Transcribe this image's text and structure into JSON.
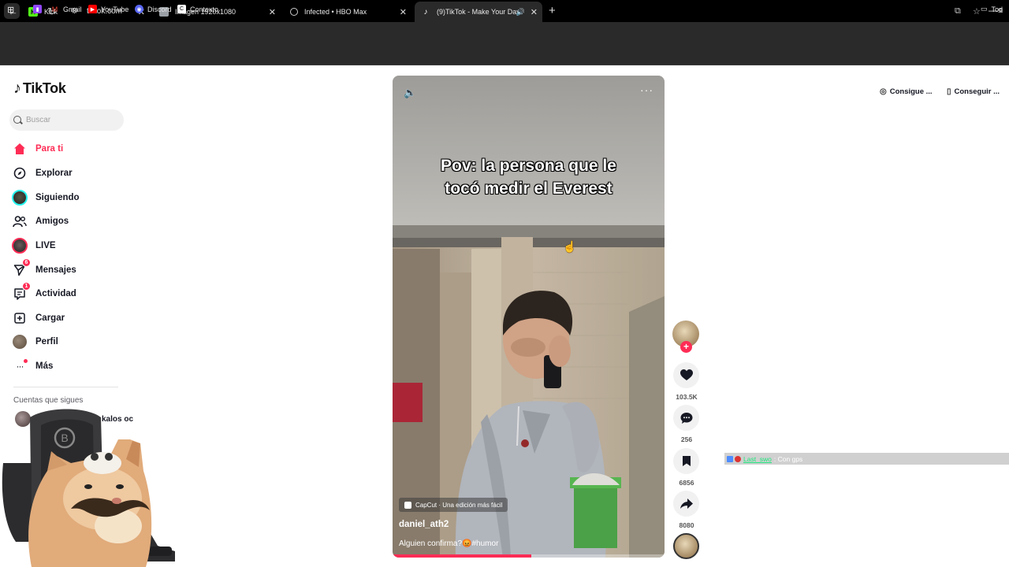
{
  "browser": {
    "tabs": [
      {
        "title": "Kick",
        "icon": "kick-icon",
        "color": "#53fc18"
      },
      {
        "title": "Imagen 1920x1080",
        "icon": "image-icon",
        "color": "#9aa0a6"
      },
      {
        "title": "Infected • HBO Max",
        "icon": "globe-icon",
        "color": "#9aa0a6"
      },
      {
        "title": "(9)TikTok - Make Your Day",
        "icon": "tiktok-icon",
        "color": "#ffffff",
        "active": true
      }
    ],
    "url": "tiktok.com",
    "bookmarks": [
      {
        "label": "Gmail",
        "icon": "gmail-icon",
        "color": "#ea4335"
      },
      {
        "label": "YouTube",
        "icon": "youtube-icon",
        "color": "#ff0000"
      },
      {
        "label": "Discord",
        "icon": "discord-icon",
        "color": "#5865f2"
      },
      {
        "label": "Contexto",
        "icon": "contexto-icon",
        "color": "#ffffff"
      }
    ],
    "bookmarks_overflow": "Tod"
  },
  "tiktok": {
    "logo": "TikTok",
    "search_placeholder": "Buscar",
    "accent": "#fe2c55",
    "nav": [
      {
        "label": "Para ti",
        "icon": "home-icon",
        "active": true
      },
      {
        "label": "Explorar",
        "icon": "compass-icon"
      },
      {
        "label": "Siguiendo",
        "icon": "following-avatar-icon"
      },
      {
        "label": "Amigos",
        "icon": "friends-icon"
      },
      {
        "label": "LIVE",
        "icon": "live-avatar-icon"
      },
      {
        "label": "Mensajes",
        "icon": "messages-icon",
        "badge": "6"
      },
      {
        "label": "Actividad",
        "icon": "activity-icon",
        "badge": "1"
      },
      {
        "label": "Cargar",
        "icon": "upload-icon"
      },
      {
        "label": "Perfil",
        "icon": "profile-avatar-icon"
      },
      {
        "label": "Más",
        "icon": "more-icon"
      }
    ],
    "following_title": "Cuentas que sigues",
    "following": [
      {
        "name": "kalos oc"
      }
    ],
    "top_right": [
      {
        "label": "Consigue ...",
        "icon": "coin-icon"
      },
      {
        "label": "Conseguir ...",
        "icon": "phone-icon"
      }
    ]
  },
  "video": {
    "caption_line1": "Pov: la persona que le",
    "caption_line2": "tocó medir el Everest",
    "capcut_label": "CapCut · Una edición más fácil",
    "username": "daniel_ath2",
    "description": "Alguien confirma?😡#humor",
    "progress": 0.51,
    "likes": "103.5K",
    "comments": "256",
    "saves": "6856",
    "shares": "8080"
  },
  "chat": {
    "user": "Last_swo",
    "message": ": Con gps"
  }
}
